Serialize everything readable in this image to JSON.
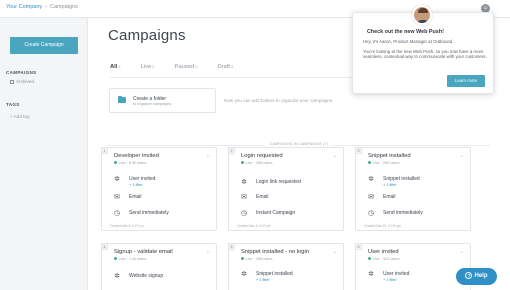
{
  "breadcrumb": {
    "company": "Your Company",
    "separator": "›",
    "current": "Campaigns"
  },
  "account_icon": "user-icon",
  "sidebar": {
    "create_button": "Create Campaign",
    "campaigns_heading": "CAMPAIGNS",
    "archived_label": "Archived",
    "tags_heading": "TAGS",
    "add_tag_label": "+ Add tag"
  },
  "main": {
    "title": "Campaigns",
    "tabs": [
      {
        "label": "All",
        "count": "4"
      },
      {
        "label": "Live",
        "count": "2"
      },
      {
        "label": "Paused",
        "count": "0"
      },
      {
        "label": "Draft",
        "count": "0"
      }
    ],
    "folder": {
      "title": "Create a folder",
      "subtitle": "to organize campaigns"
    },
    "folder_hint": "Now you can add folders to organize your campaigns.",
    "divider_label": "CAMPAIGNS IN CAMPAIGNS (7)"
  },
  "cards": [
    {
      "num": "1",
      "title": "Developer invited",
      "status": "Live · 8.9k users",
      "steps": [
        {
          "icon": "trigger-icon",
          "text": "User invited",
          "filter": "+ 1 filter"
        },
        {
          "icon": "email-icon",
          "text": "Email",
          "filter": ""
        },
        {
          "icon": "timer-icon",
          "text": "Send immediately",
          "filter": ""
        }
      ],
      "footer": "Created Mar 8, 6:07 pm"
    },
    {
      "num": "2",
      "title": "Login requested",
      "status": "Live · 185 users",
      "steps": [
        {
          "icon": "trigger-icon",
          "text": "Login link requested",
          "filter": ""
        },
        {
          "icon": "email-icon",
          "text": "Email",
          "filter": ""
        },
        {
          "icon": "timer-icon",
          "text": "Instant Campaign",
          "filter": ""
        }
      ],
      "footer": "Created Mar 8, 6:07 pm"
    },
    {
      "num": "3",
      "title": "Snippet installed",
      "status": "Live · 255 users",
      "steps": [
        {
          "icon": "trigger-icon",
          "text": "Snippet installed",
          "filter": "+ 1 filter"
        },
        {
          "icon": "email-icon",
          "text": "Email",
          "filter": ""
        },
        {
          "icon": "timer-icon",
          "text": "Send immediately",
          "filter": ""
        }
      ],
      "footer": "Created Mar 23, 10:29 pm"
    },
    {
      "num": "4",
      "title": "Signup - validate email",
      "status": "Live · 1.1k users",
      "steps": [
        {
          "icon": "trigger-icon",
          "text": "Website signup",
          "filter": ""
        }
      ],
      "footer": ""
    },
    {
      "num": "5",
      "title": "Snippet installed - no login",
      "status": "Live · 185 users",
      "steps": [
        {
          "icon": "trigger-icon",
          "text": "Snippet installed",
          "filter": "+ 1 filter"
        }
      ],
      "footer": ""
    },
    {
      "num": "6",
      "title": "User invited",
      "status": "Live · 322 users",
      "steps": [
        {
          "icon": "trigger-icon",
          "text": "User invited",
          "filter": "+ 1 filter"
        }
      ],
      "footer": ""
    }
  ],
  "popover": {
    "title": "Check out the new Web Push!",
    "greeting": "Hey, it's Aaron, Product Manager at Outbound.",
    "body": "You're looking at the new Web Push, so you now have a more seamless, contextual way to communicate with your customers.",
    "button": "Learn more"
  },
  "help_label": "Help"
}
